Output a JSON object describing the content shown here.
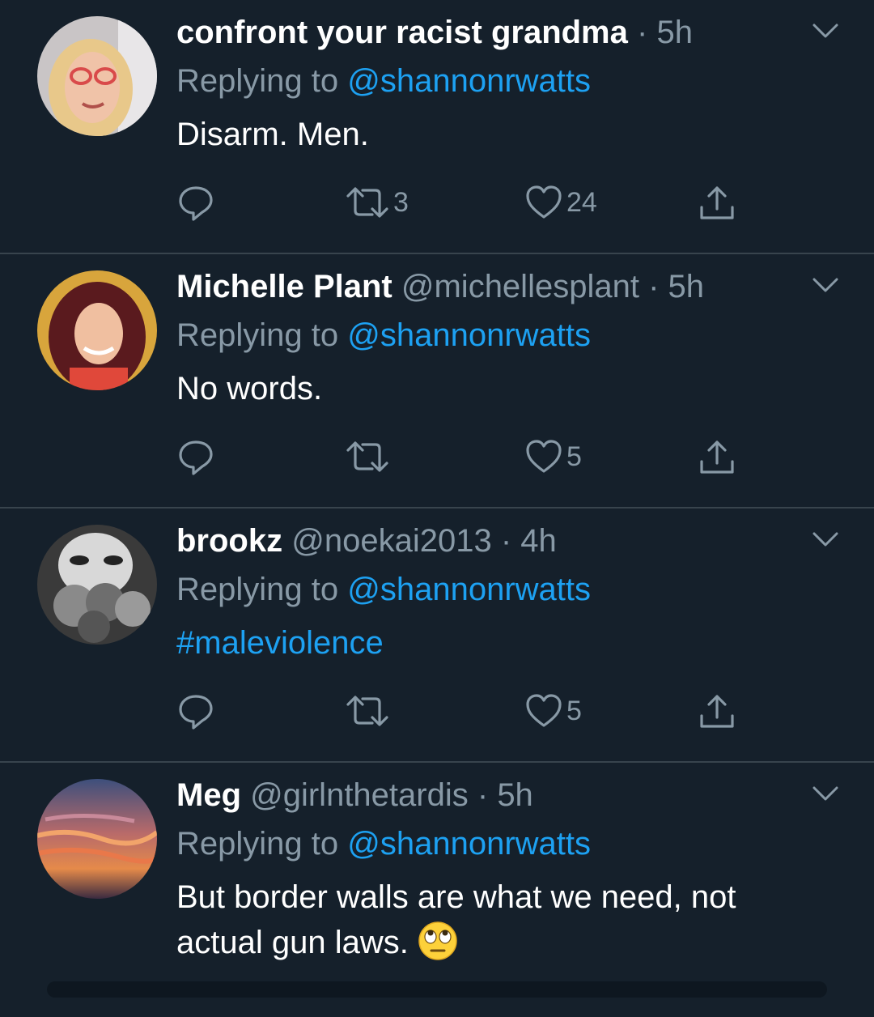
{
  "tweets": [
    {
      "name": "confront your racist grandma",
      "handle": "",
      "sep": "·",
      "time": "5h",
      "replying_prefix": "Replying to ",
      "replying_to": "@shannonrwatts",
      "text": "Disarm. Men.",
      "text_kind": "plain",
      "retweets": "3",
      "likes": "24"
    },
    {
      "name": "Michelle Plant",
      "handle": "@michellesplant",
      "sep": "·",
      "time": "5h",
      "replying_prefix": "Replying to ",
      "replying_to": "@shannonrwatts",
      "text": "No words.",
      "text_kind": "plain",
      "retweets": "",
      "likes": "5"
    },
    {
      "name": "brookz",
      "handle": "@noekai2013",
      "sep": "·",
      "time": "4h",
      "replying_prefix": "Replying to ",
      "replying_to": "@shannonrwatts",
      "text": "#maleviolence",
      "text_kind": "hashtag",
      "retweets": "",
      "likes": "5"
    },
    {
      "name": "Meg",
      "handle": "@girlnthetardis",
      "sep": "·",
      "time": "5h",
      "replying_prefix": "Replying to ",
      "replying_to": "@shannonrwatts",
      "text_line1": "But border walls are what we need, not",
      "text_line2": "actual gun laws. ",
      "text_kind": "plain",
      "emoji": "face-with-rolling-eyes"
    }
  ],
  "icons": {
    "reply": "reply-icon",
    "retweet": "retweet-icon",
    "like": "heart-icon",
    "share": "share-icon",
    "caret": "chevron-down-icon"
  },
  "colors": {
    "background": "#15202b",
    "divider": "#38444d",
    "secondary_text": "#8899a6",
    "link": "#1da1f2",
    "primary_text": "#ffffff"
  }
}
